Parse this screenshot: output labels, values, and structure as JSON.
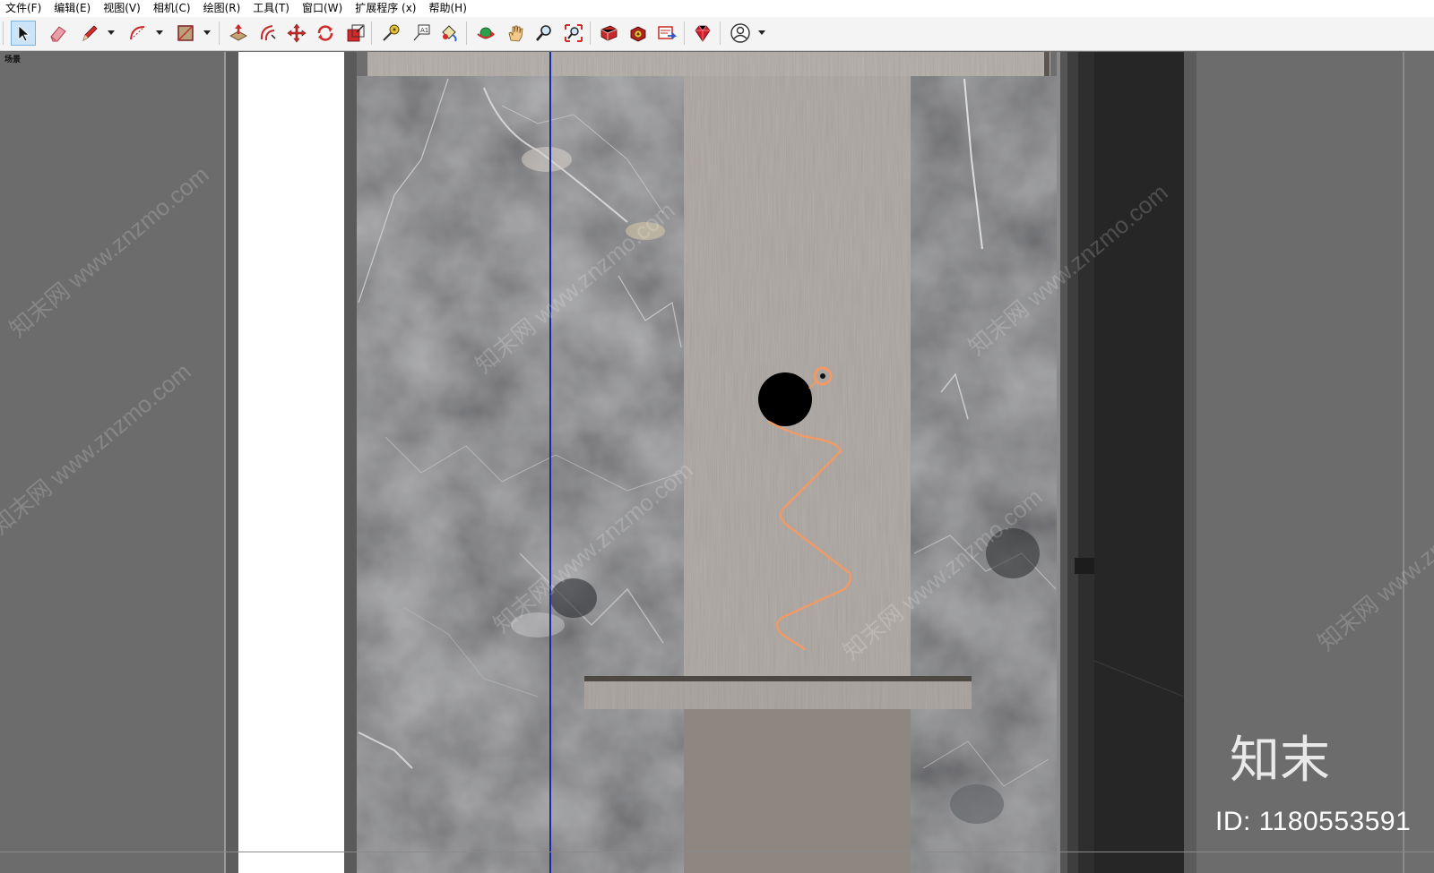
{
  "menu": {
    "items": [
      "文件(F)",
      "编辑(E)",
      "视图(V)",
      "相机(C)",
      "绘图(R)",
      "工具(T)",
      "窗口(W)",
      "扩展程序 (x)",
      "帮助(H)"
    ]
  },
  "toolbar": {
    "tools": [
      {
        "name": "select-tool",
        "icon": "arrow-cursor-icon",
        "active": true
      },
      {
        "name": "eraser-tool",
        "icon": "eraser-icon"
      },
      {
        "name": "line-tool",
        "icon": "pencil-icon"
      },
      {
        "name": "arc-tool",
        "icon": "arc-icon"
      },
      {
        "name": "rectangle-tool",
        "icon": "rectangle-icon"
      },
      {
        "name": "push-pull-tool",
        "icon": "push-pull-icon"
      },
      {
        "name": "offset-tool",
        "icon": "offset-icon"
      },
      {
        "name": "move-tool",
        "icon": "move-icon"
      },
      {
        "name": "rotate-tool",
        "icon": "rotate-icon"
      },
      {
        "name": "scale-tool",
        "icon": "scale-icon"
      },
      {
        "name": "tape-measure-tool",
        "icon": "tape-measure-icon"
      },
      {
        "name": "text-tool",
        "icon": "text-label-icon"
      },
      {
        "name": "paint-bucket-tool",
        "icon": "paint-bucket-icon"
      },
      {
        "name": "orbit-tool",
        "icon": "orbit-icon"
      },
      {
        "name": "pan-tool",
        "icon": "hand-icon"
      },
      {
        "name": "zoom-tool",
        "icon": "magnifier-icon"
      },
      {
        "name": "zoom-extents-tool",
        "icon": "zoom-extents-icon"
      },
      {
        "name": "warehouse-tool",
        "icon": "3d-warehouse-icon"
      },
      {
        "name": "extension-warehouse-tool",
        "icon": "extension-warehouse-icon"
      },
      {
        "name": "send-to-layout-tool",
        "icon": "layout-icon"
      },
      {
        "name": "ruby-console-tool",
        "icon": "ruby-gem-icon"
      },
      {
        "name": "account-tool",
        "icon": "user-account-icon"
      }
    ]
  },
  "viewport": {
    "scene_label": "场景",
    "watermark_text": "知末网 www.znzmo.com",
    "logo_text": "知末",
    "id_text": "ID: 1180553591"
  },
  "colors": {
    "background": "#6e6e6e",
    "marble": "#4d4f51",
    "wood": "#8f8882",
    "sketch_line": "#f29a66",
    "axis_blue": "#1a2aa0"
  }
}
